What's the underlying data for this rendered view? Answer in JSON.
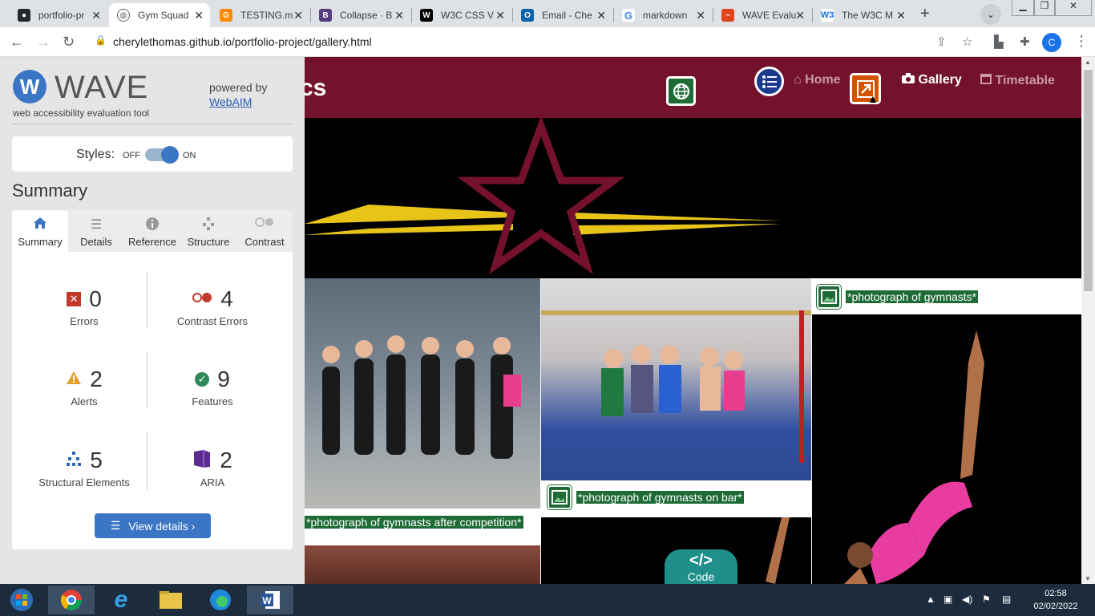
{
  "browser": {
    "tabs": [
      {
        "title": "portfolio-pr",
        "favicon": "github-icon",
        "color": "#24292e"
      },
      {
        "title": "Gym Squad",
        "favicon": "globe-icon",
        "color": "#5f6368",
        "active": true
      },
      {
        "title": "TESTING.m",
        "favicon": "gitpod-icon",
        "color": "#ff8a00"
      },
      {
        "title": "Collapse · B",
        "favicon": "bootstrap-icon",
        "color": "#563d7c"
      },
      {
        "title": "W3C CSS V",
        "favicon": "w3c-icon",
        "color": "#000000"
      },
      {
        "title": "Email - Che",
        "favicon": "outlook-icon",
        "color": "#0a64ad"
      },
      {
        "title": "markdown",
        "favicon": "google-icon",
        "color": "#4285f4"
      },
      {
        "title": "WAVE Evalu",
        "favicon": "wave-icon",
        "color": "#e0441a"
      },
      {
        "title": "The W3C M",
        "favicon": "w3schools-icon",
        "color": "#1a73e8"
      }
    ],
    "url": "cherylethomas.github.io/portfolio-project/gallery.html",
    "profile_initial": "C"
  },
  "wave": {
    "title": "WAVE",
    "subtitle": "web accessibility evaluation tool",
    "powered_by": "powered by",
    "webaim": "WebAIM",
    "styles_label": "Styles:",
    "styles_off": "OFF",
    "styles_on": "ON",
    "summary_heading": "Summary",
    "tabs": [
      {
        "label": "Summary",
        "icon": "home-icon"
      },
      {
        "label": "Details",
        "icon": "list-icon"
      },
      {
        "label": "Reference",
        "icon": "info-icon"
      },
      {
        "label": "Structure",
        "icon": "structure-icon"
      },
      {
        "label": "Contrast",
        "icon": "contrast-icon"
      }
    ],
    "stats": [
      {
        "count": "0",
        "label": "Errors",
        "icon": "error-icon",
        "color": "#c0392b"
      },
      {
        "count": "4",
        "label": "Contrast Errors",
        "icon": "contrast-error-icon",
        "color": "#c0392b"
      },
      {
        "count": "2",
        "label": "Alerts",
        "icon": "alert-icon",
        "color": "#e0a030"
      },
      {
        "count": "9",
        "label": "Features",
        "icon": "feature-icon",
        "color": "#2e8b57"
      },
      {
        "count": "5",
        "label": "Structural Elements",
        "icon": "structure-icon",
        "color": "#2a6ab8"
      },
      {
        "count": "2",
        "label": "ARIA",
        "icon": "aria-icon",
        "color": "#5b2d8e"
      }
    ],
    "view_details": "View details ›"
  },
  "site": {
    "brand_fragment": "cs",
    "nav": [
      {
        "label": "Home",
        "icon": "house-icon"
      },
      {
        "label": "Gallery",
        "icon": "camera-icon"
      },
      {
        "label": "Timetable",
        "icon": "calendar-icon"
      }
    ],
    "captions": [
      "*photograph of gymnasts*",
      "*photograph of gymnasts on bar*",
      "*photograph of gymnasts after competition*"
    ],
    "code_badge": "Code",
    "code_symbol": "</>"
  },
  "taskbar": {
    "time": "02:58",
    "date": "02/02/2022"
  }
}
